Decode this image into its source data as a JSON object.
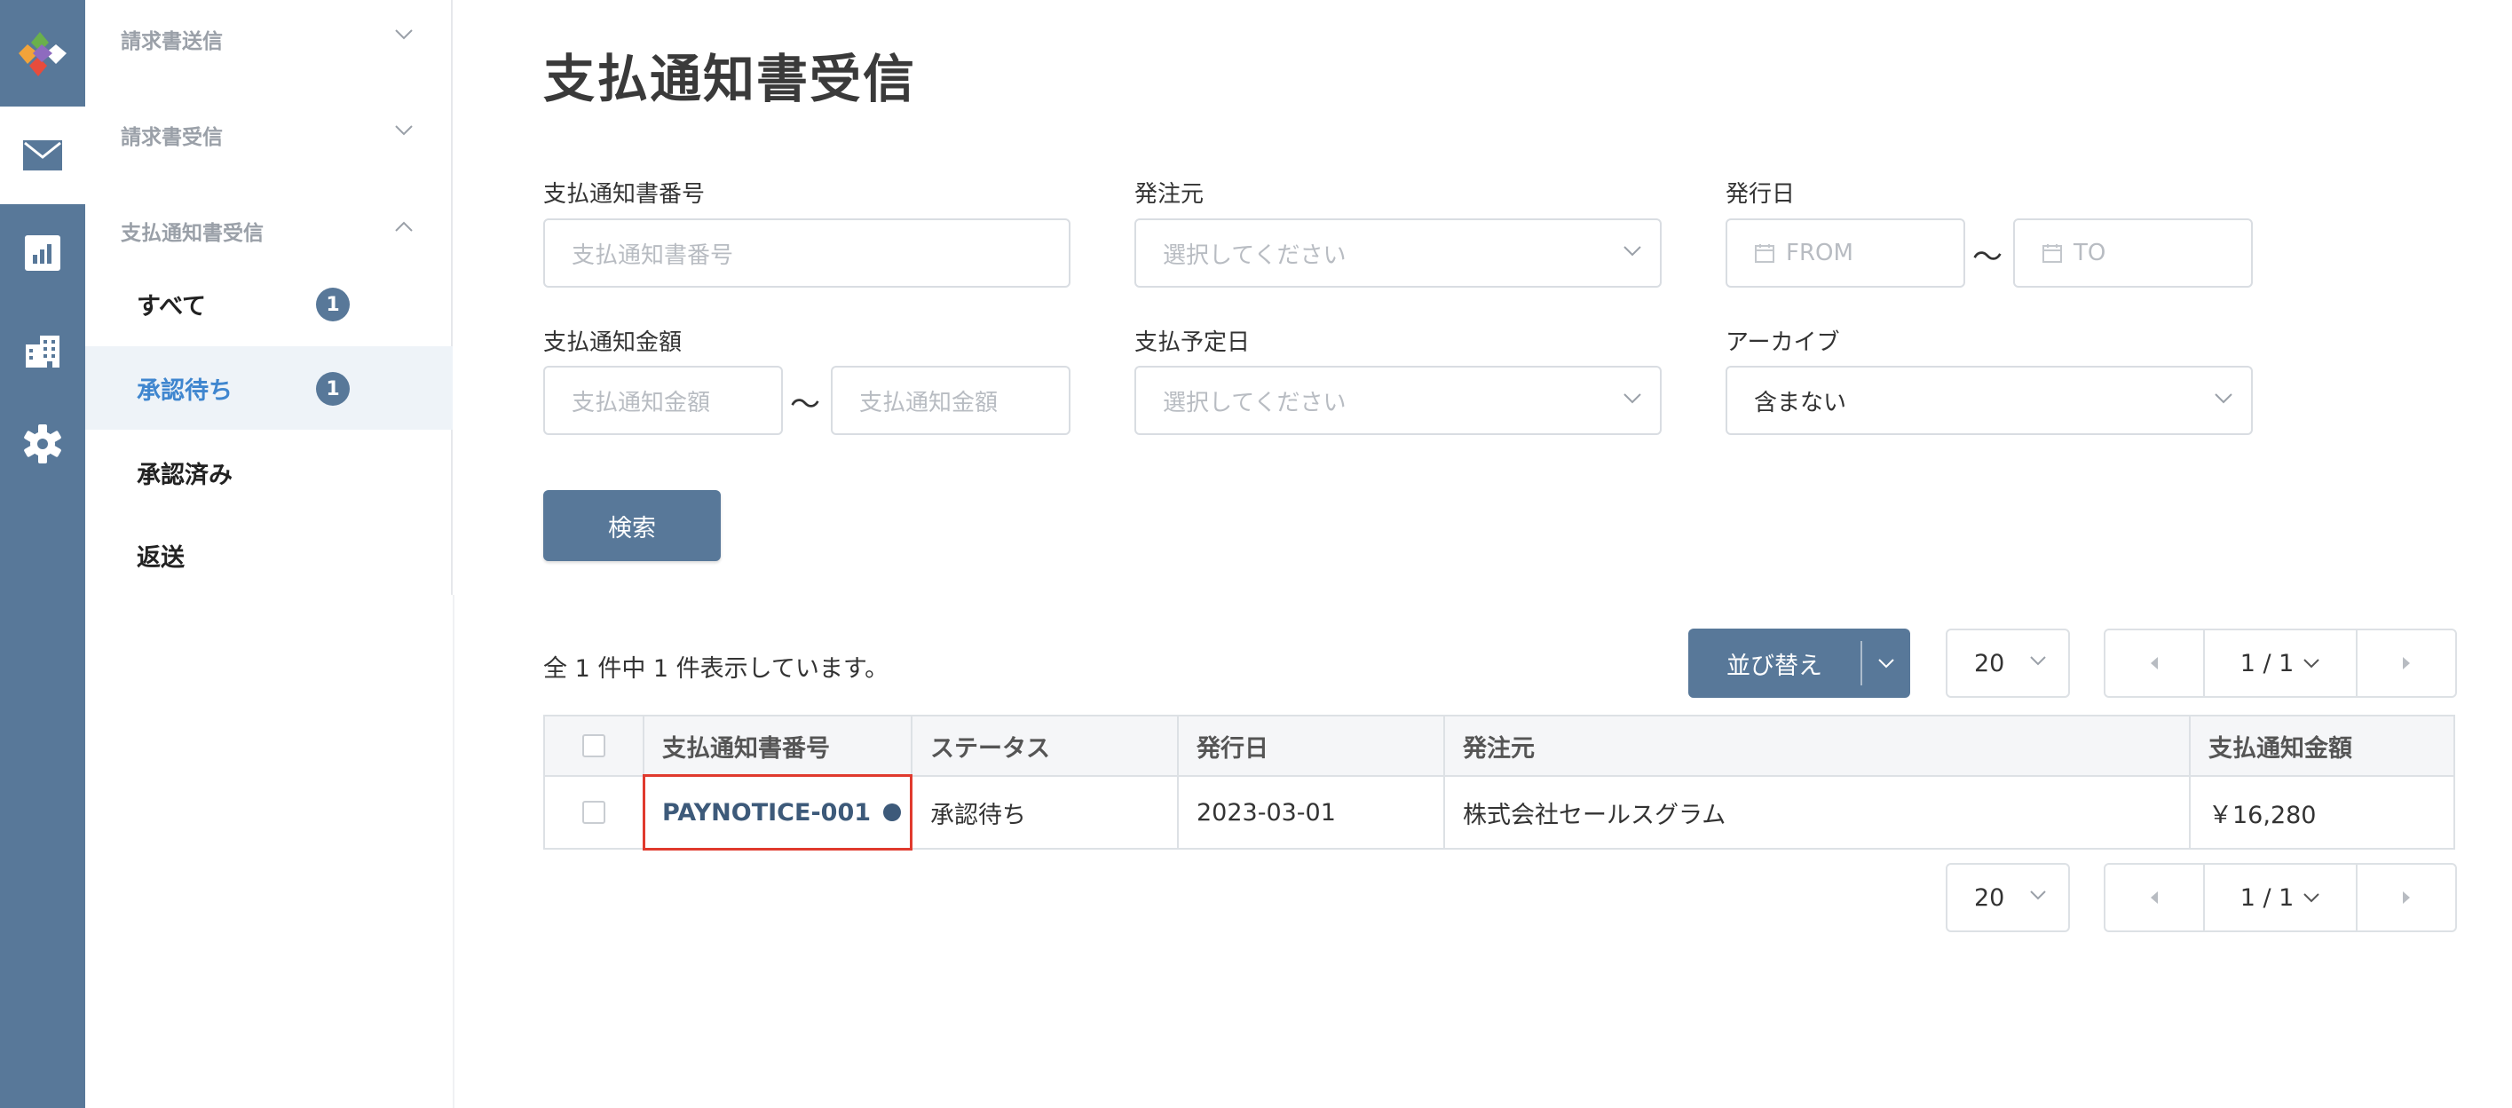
{
  "rail": {
    "items": [
      {
        "icon": "app-logo-icon"
      },
      {
        "icon": "mail-icon"
      },
      {
        "icon": "chart-icon"
      },
      {
        "icon": "building-icon"
      },
      {
        "icon": "gear-icon"
      }
    ]
  },
  "subnav": {
    "groups": [
      {
        "label": "請求書送信"
      },
      {
        "label": "請求書受信"
      },
      {
        "label": "支払通知書受信"
      }
    ],
    "items": [
      {
        "label": "すべて",
        "badge": "1"
      },
      {
        "label": "承認待ち",
        "badge": "1"
      },
      {
        "label": "承認済み"
      },
      {
        "label": "返送"
      }
    ]
  },
  "page": {
    "title": "支払通知書受信"
  },
  "filters": {
    "notice_number": {
      "label": "支払通知書番号",
      "placeholder": "支払通知書番号"
    },
    "orderer": {
      "label": "発注元",
      "placeholder": "選択してください"
    },
    "issue_date": {
      "label": "発行日",
      "from": "FROM",
      "to": "TO",
      "tilde": "〜"
    },
    "amount": {
      "label": "支払通知金額",
      "from_placeholder": "支払通知金額",
      "to_placeholder": "支払通知金額",
      "tilde": "〜"
    },
    "payment_date": {
      "label": "支払予定日",
      "placeholder": "選択してください"
    },
    "archive": {
      "label": "アーカイブ",
      "value": "含まない"
    }
  },
  "search_button": "検索",
  "results": {
    "count_text": "全 1 件中 1 件表示しています。",
    "sort_label": "並び替え",
    "per_page": "20",
    "page_indicator": "1 / 1"
  },
  "table": {
    "columns": [
      "支払通知書番号",
      "ステータス",
      "発行日",
      "発注元",
      "支払通知金額"
    ],
    "rows": [
      {
        "number": "PAYNOTICE-001",
        "status": "承認待ち",
        "issue_date": "2023-03-01",
        "orderer": "株式会社セールスグラム",
        "amount": "￥16,280"
      }
    ]
  },
  "colors": {
    "primary": "#587899",
    "link": "#3f86cf",
    "highlight": "#e03a2e"
  }
}
